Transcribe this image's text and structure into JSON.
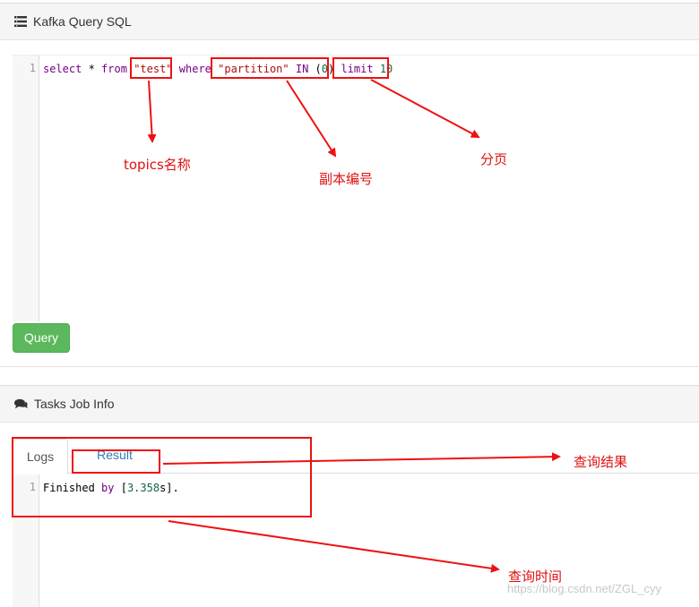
{
  "query_panel": {
    "title": "Kafka Query SQL",
    "icon": "list-icon",
    "editor": {
      "line_number": "1",
      "tokens": [
        {
          "text": "select",
          "kind": "kw"
        },
        {
          "text": " * ",
          "kind": "plain"
        },
        {
          "text": "from",
          "kind": "kw"
        },
        {
          "text": " ",
          "kind": "plain"
        },
        {
          "text": "\"test\"",
          "kind": "str"
        },
        {
          "text": " ",
          "kind": "plain"
        },
        {
          "text": "where",
          "kind": "kw"
        },
        {
          "text": " ",
          "kind": "plain"
        },
        {
          "text": "\"partition\"",
          "kind": "str"
        },
        {
          "text": " ",
          "kind": "plain"
        },
        {
          "text": "IN",
          "kind": "kw"
        },
        {
          "text": " (",
          "kind": "plain"
        },
        {
          "text": "0",
          "kind": "num"
        },
        {
          "text": ") ",
          "kind": "plain"
        },
        {
          "text": "limit",
          "kind": "kw"
        },
        {
          "text": " ",
          "kind": "plain"
        },
        {
          "text": "10",
          "kind": "num"
        }
      ]
    },
    "query_button": "Query"
  },
  "tasks_panel": {
    "title": "Tasks Job Info",
    "icon": "comments-icon",
    "tabs": [
      {
        "label": "Logs",
        "active": true
      },
      {
        "label": "Result",
        "active": false
      }
    ],
    "log_editor": {
      "line_number": "1",
      "tokens": [
        {
          "text": "Finished",
          "kind": "plain"
        },
        {
          "text": " ",
          "kind": "plain"
        },
        {
          "text": "by",
          "kind": "kw"
        },
        {
          "text": " [",
          "kind": "plain"
        },
        {
          "text": "3.358",
          "kind": "num"
        },
        {
          "text": "s].",
          "kind": "plain"
        }
      ]
    }
  },
  "annotations": {
    "topics_name": "topics名称",
    "partition_number": "副本编号",
    "paging": "分页",
    "query_result": "查询结果",
    "query_time": "查询时间"
  },
  "watermark": "https://blog.csdn.net/ZGL_cyy",
  "colors": {
    "annotation_red": "#ee1111",
    "button_green": "#5cb85c",
    "keyword": "#770088",
    "string": "#aa1111",
    "number": "#116644",
    "link_blue": "#337ab7"
  }
}
